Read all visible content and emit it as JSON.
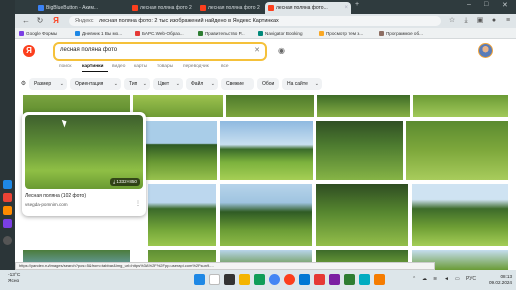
{
  "browser": {
    "tabs": [
      {
        "label": "BigBlueButton - Аким..."
      },
      {
        "label": "лесная поляна фото 2"
      },
      {
        "label": "лесная поляна фото 2"
      },
      {
        "label": "лесная поляна фото..."
      }
    ],
    "window_controls": {
      "minimize": "–",
      "maximize": "□",
      "close": "✕"
    },
    "address_host": "Яндекс",
    "address_text": "лесная поляна фото: 2 тыс изображений найдено в Яндекс Картинках",
    "bookmarks": [
      "Google Формы",
      "Дневник 1 Вы мо...",
      "БАРС.Web-Образ...",
      "Правительство Р...",
      "Navigator Booking",
      "Просмотр тем з...",
      "Программое об..."
    ]
  },
  "page": {
    "logo": "Я",
    "search_query": "лесная поляна фото",
    "clear_symbol": "✕",
    "services": [
      "поиск",
      "картинки",
      "видео",
      "карты",
      "товары",
      "переводчик",
      "все"
    ],
    "filters": [
      "Размер",
      "Ориентация",
      "Тип",
      "Цвет",
      "Файл",
      "Свежие",
      "Обои",
      "На сайте"
    ],
    "hover_card": {
      "size": "1332×850",
      "title": "Лесная поляна (102 фото)",
      "site": "vsegda-pomnim.com",
      "more": "⋮"
    },
    "status_url": "https://yandex.ru/images/search?pos=5&from=tabbar&img_url=https%3A%2F%2Fpp.userapi.com%2Fsun9-..."
  },
  "taskbar": {
    "weather_temp": "-13°C",
    "weather_text": "Ясно",
    "lang": "РУС",
    "time": "08:13",
    "date": "09.02.2024"
  }
}
